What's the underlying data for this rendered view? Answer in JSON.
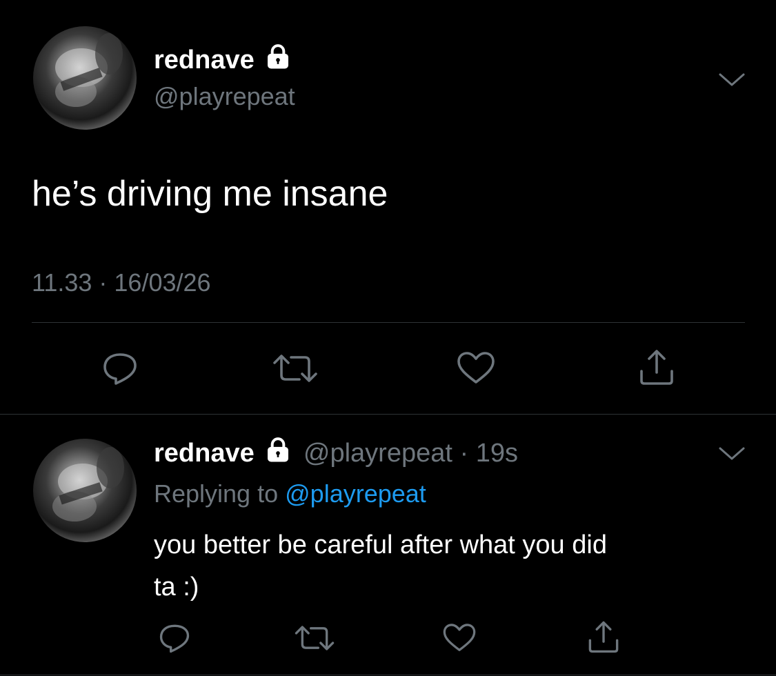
{
  "main_tweet": {
    "display_name": "rednave",
    "handle": "@playrepeat",
    "text": "he’s driving me insane",
    "timestamp": "11.33 · 16/03/26",
    "actions": [
      "reply-icon",
      "retweet-icon",
      "like-icon",
      "share-icon"
    ]
  },
  "reply_tweet": {
    "display_name": "rednave",
    "handle": "@playrepeat",
    "age": "· 19s",
    "replying_prefix": "Replying to",
    "replying_to": "@playrepeat",
    "text_line1": "you better be careful after what you did",
    "text_line2": "ta :)",
    "actions": [
      "reply-icon",
      "retweet-icon",
      "like-icon",
      "share-icon"
    ]
  },
  "colors": {
    "background": "#000000",
    "text": "#ffffff",
    "muted": "#6e767d",
    "link": "#1d9bf0",
    "divider": "#2f3336"
  }
}
